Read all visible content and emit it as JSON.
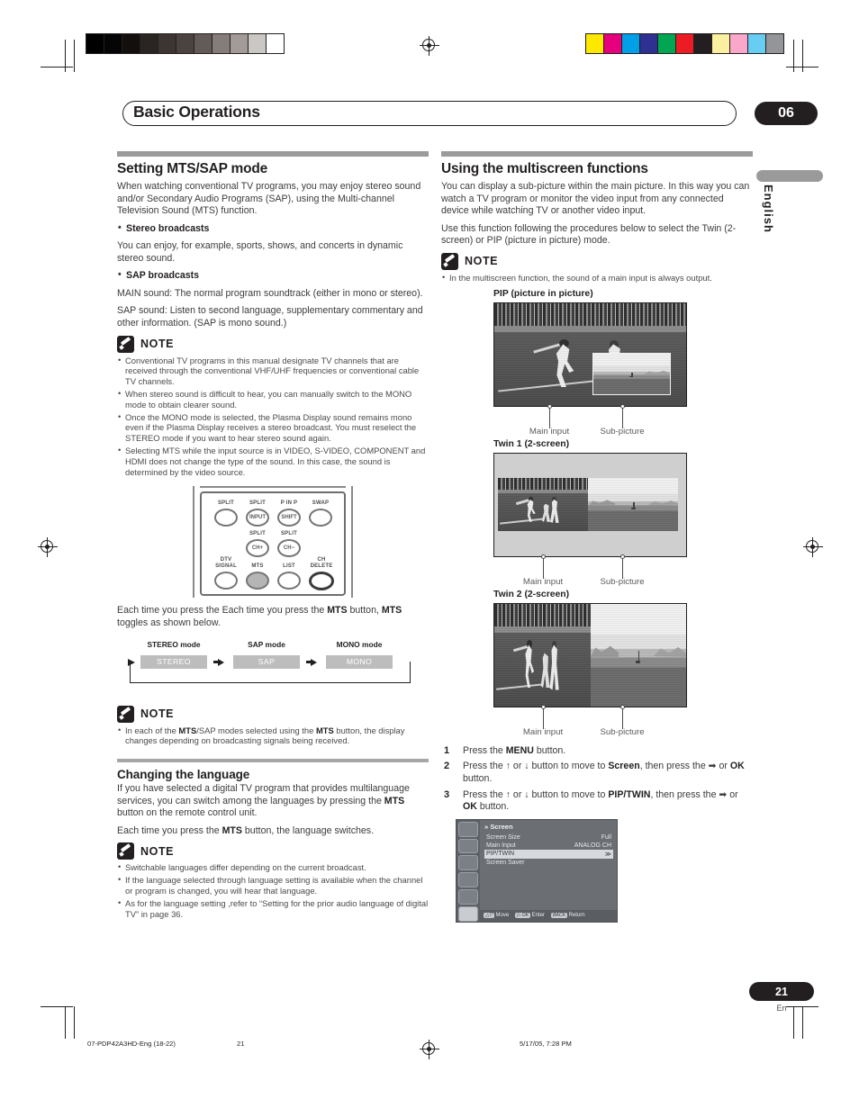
{
  "header": {
    "chapter_title": "Basic Operations",
    "chapter_number": "06",
    "side_tab": "English"
  },
  "left_column": {
    "section1": {
      "heading": "Setting MTS/SAP mode",
      "intro": "When watching conventional TV programs, you may enjoy stereo sound and/or Secondary Audio Programs (SAP), using the Multi-channel Television Sound (MTS) function.",
      "bullets": [
        {
          "label": "Stereo broadcasts",
          "text": "You can enjoy, for example, sports, shows, and concerts in dynamic stereo sound."
        },
        {
          "label": "SAP broadcasts",
          "text": "MAIN sound: The normal program soundtrack (either in mono or stereo).",
          "text2": "SAP sound: Listen to second language, supplementary commentary and other information. (SAP is mono sound.)"
        }
      ],
      "note_label": "NOTE",
      "notes": [
        "Conventional TV programs in this manual designate TV channels that are received through the conventional VHF/UHF frequencies or conventional cable TV channels.",
        "When stereo sound is difficult to hear, you can manually switch to the MONO mode to obtain clearer sound.",
        "Once the MONO mode is selected, the Plasma Display sound remains mono even if the Plasma Display receives a stereo broadcast. You must reselect the STEREO mode if you want to hear stereo sound again.",
        "Selecting MTS while the input source is in VIDEO, S-VIDEO, COMPONENT and HDMI does not change the type of the sound. In this case, the sound is determined by the video source."
      ],
      "remote": {
        "buttons": [
          {
            "top_label": "SPLIT",
            "label": ""
          },
          {
            "top_label": "SPLIT",
            "label": "INPUT"
          },
          {
            "top_label": "P IN P",
            "label": "SHIFT"
          },
          {
            "top_label": "SWAP",
            "label": ""
          },
          {
            "top_label": "SPLIT",
            "label": "CH+"
          },
          {
            "top_label": "SPLIT",
            "label": "CH−"
          },
          {
            "top_label": "DTV SIGNAL",
            "label": ""
          },
          {
            "top_label": "MTS",
            "label": ""
          },
          {
            "top_label": "LIST",
            "label": ""
          },
          {
            "top_label": "CH DELETE",
            "label": ""
          }
        ]
      },
      "toggle_intro": "Each time you press the MTS button, MTS toggles as shown below.",
      "flow": {
        "captions": [
          "STEREO mode",
          "SAP mode",
          "MONO mode"
        ],
        "cells": [
          "STEREO",
          "SAP",
          "MONO"
        ]
      },
      "note2_label": "NOTE",
      "notes2": [
        "In each of the MTS/SAP modes selected using the MTS button, the display changes depending on broadcasting signals being received."
      ]
    },
    "section2": {
      "heading": "Changing the language",
      "intro": "If you have selected a digital TV program that provides multilanguage services, you can switch among the languages by pressing the MTS button on the remote control unit.",
      "line2": "Each time you press the MTS button, the language switches.",
      "note_label": "NOTE",
      "notes": [
        "Switchable languages differ depending on the current broadcast.",
        "If the language selected through language setting is available when the channel or program is changed, you will hear that language.",
        "As for the language setting ,refer to “Setting for the prior audio language of digital TV” in page 36."
      ]
    }
  },
  "right_column": {
    "heading": "Using the multiscreen functions",
    "intro": "You can display a sub-picture within the main picture. In this way you can watch a TV program or monitor the video input from any connected device while watching TV or another video input.",
    "intro2": "Use this function following the procedures below to select the Twin (2-screen) or PIP (picture in picture) mode.",
    "note_label": "NOTE",
    "notes": [
      "In the multiscreen function, the sound of a main input is always output."
    ],
    "figures": [
      {
        "caption": "PIP (picture in picture)",
        "label_main": "Main input",
        "label_sub": "Sub-picture"
      },
      {
        "caption": "Twin 1 (2-screen)",
        "label_main": "Main input",
        "label_sub": "Sub-picture"
      },
      {
        "caption": "Twin 2 (2-screen)",
        "label_main": "Main input",
        "label_sub": "Sub-picture"
      }
    ],
    "steps": [
      {
        "num": "1",
        "text": "Press the MENU button."
      },
      {
        "num": "2",
        "text": "Press the ↑ or ↓ button to move to Screen, then press the ➡ or OK button."
      },
      {
        "num": "3",
        "text": "Press the ↑ or ↓ button to move to PIP/TWIN, then press the ➡ or OK button."
      }
    ],
    "osd": {
      "title": "Screen",
      "rows": [
        {
          "label": "Screen Size",
          "value": "Full"
        },
        {
          "label": "Main Input",
          "value": "ANALOG CH"
        },
        {
          "label": "PIP/TWIN",
          "value": "≫"
        },
        {
          "label": "Screen Saver",
          "value": ""
        }
      ],
      "footer": [
        {
          "key": "△▽",
          "text": "Move"
        },
        {
          "key": "▷ OK",
          "text": "Enter"
        },
        {
          "key": "BACK",
          "text": "Return"
        }
      ]
    }
  },
  "footer": {
    "file": "07-PDP42A3HD-Eng (18-22)",
    "page_small": "21",
    "timestamp": "5/17/05, 7:28 PM",
    "page_badge": "21",
    "page_lang": "En"
  },
  "print_marks": {
    "gray_steps": [
      "#000000",
      "#050505",
      "#120f0c",
      "#2a2522",
      "#3c3531",
      "#4b4340",
      "#635b57",
      "#857d79",
      "#a39b97",
      "#cbc7c4",
      "#ffffff"
    ],
    "color_bars": [
      "#ffe800",
      "#e6007e",
      "#00a0e9",
      "#2e3192",
      "#00a651",
      "#ed1c24",
      "#231f20",
      "#fbf0a0",
      "#f9a8c9",
      "#67cdf2",
      "#939598"
    ]
  }
}
